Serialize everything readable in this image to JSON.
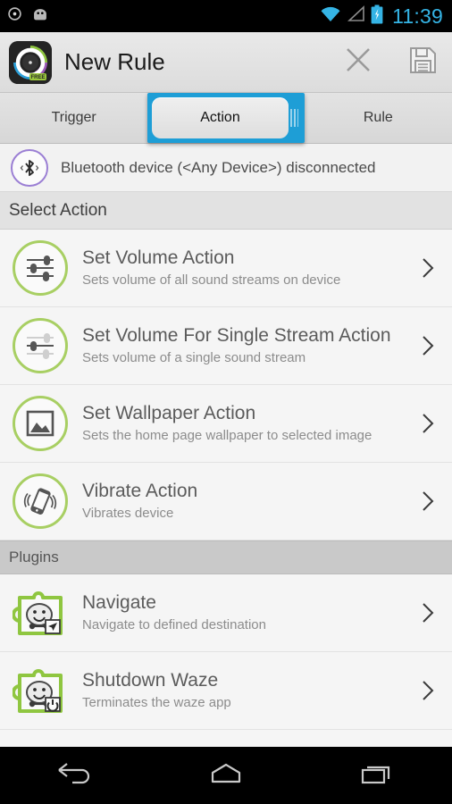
{
  "statusbar": {
    "time": "11:39",
    "icons": [
      "circle-dot-icon",
      "android-head-icon",
      "wifi-icon",
      "signal-icon",
      "battery-charging-icon"
    ],
    "time_color": "#35b4e5"
  },
  "actionbar": {
    "app_icon": "app-logo-icon",
    "title": "New Rule",
    "cancel_label": "close-icon",
    "save_label": "save-icon"
  },
  "tabs": {
    "selected_index": 1,
    "items": [
      {
        "label": "Trigger"
      },
      {
        "label": "Action"
      },
      {
        "label": "Rule"
      }
    ],
    "accent": "#1e9ed6"
  },
  "trigger": {
    "icon": "bluetooth-icon",
    "text": "Bluetooth device (<Any Device>) disconnected",
    "ring_color": "#9b7fd4"
  },
  "sections": [
    {
      "header": "Select Action",
      "style": "light",
      "items": [
        {
          "icon": "sliders-icon",
          "title": "Set Volume Action",
          "subtitle": "Sets volume of all sound streams on device"
        },
        {
          "icon": "sliders-icon",
          "title": "Set Volume For Single Stream Action",
          "subtitle": "Sets volume of a single sound stream"
        },
        {
          "icon": "image-icon",
          "title": "Set Wallpaper Action",
          "subtitle": "Sets the home page wallpaper to selected image"
        },
        {
          "icon": "vibrate-icon",
          "title": "Vibrate Action",
          "subtitle": "Vibrates device"
        }
      ]
    },
    {
      "header": "Plugins",
      "style": "dark",
      "items": [
        {
          "icon": "waze-navigate-plugin-icon",
          "title": "Navigate",
          "subtitle": "Navigate to defined destination"
        },
        {
          "icon": "waze-shutdown-plugin-icon",
          "title": "Shutdown Waze",
          "subtitle": "Terminates the waze app"
        }
      ]
    }
  ],
  "navbar": {
    "back": "back-icon",
    "home": "home-icon",
    "recents": "recents-icon"
  },
  "theme": {
    "green_ring": "#a8cf63",
    "list_bg": "#f5f5f5",
    "title_color": "#5b5b5b",
    "sub_color": "#8c8c8c"
  }
}
